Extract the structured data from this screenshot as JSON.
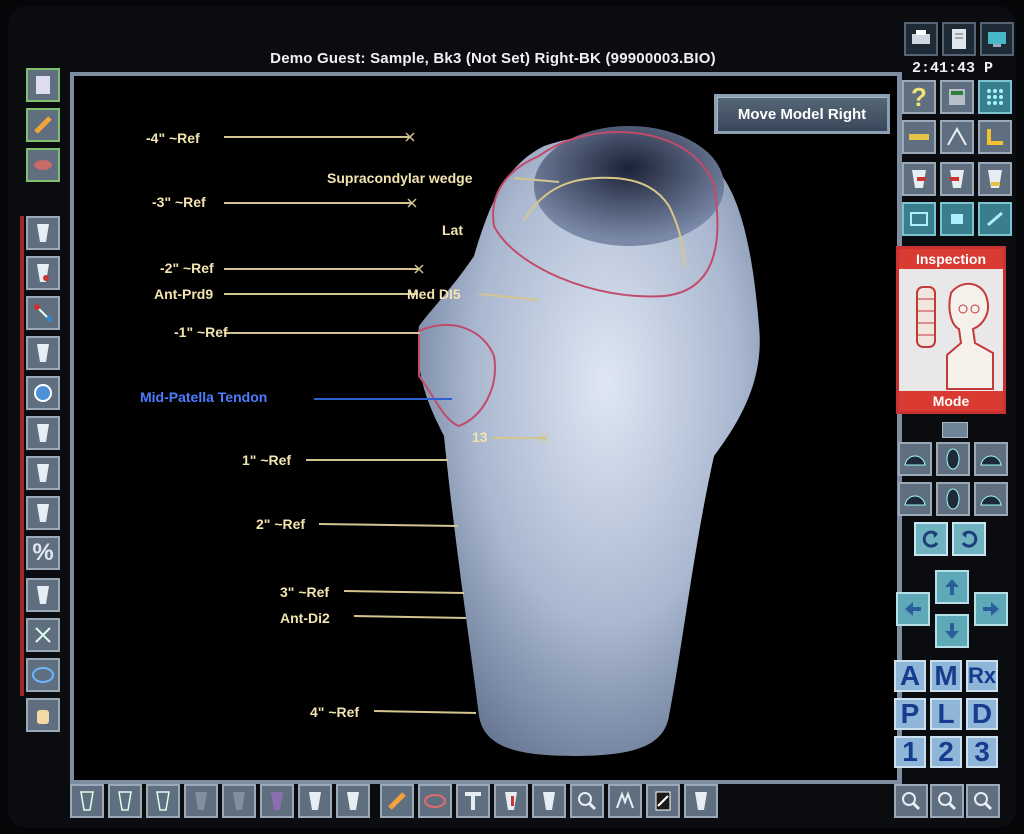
{
  "window": {
    "title": "Demo Guest: Sample, Bk3 (Not Set) Right-BK (99900003.BIO)",
    "clock": "2:41:43 P"
  },
  "viewport": {
    "move_button_label": "Move Model Right",
    "labels": {
      "ref_m4": "-4\" ~Ref",
      "supracondylar": "Supracondylar wedge",
      "ref_m3": "-3\" ~Ref",
      "lat": "Lat",
      "ref_m2": "-2\" ~Ref",
      "ant_prd": "Ant-Prd9",
      "med_di": "Med DI5",
      "ref_m1": "-1\" ~Ref",
      "mid_patella": "Mid-Patella Tendon",
      "num_13": "13",
      "ref_1": "1\" ~Ref",
      "ref_2": "2\" ~Ref",
      "ref_3": "3\" ~Ref",
      "ant_di": "Ant-Di2",
      "ref_4": "4\" ~Ref"
    }
  },
  "inspection": {
    "title": "Inspection",
    "mode": "Mode"
  },
  "letters": [
    "A",
    "M",
    "Rx",
    "P",
    "L",
    "D",
    "1",
    "2",
    "3"
  ],
  "colors": {
    "label": "#f3e3b0",
    "tendon_line": "#4d7cff",
    "accent_red": "#d93a31"
  }
}
